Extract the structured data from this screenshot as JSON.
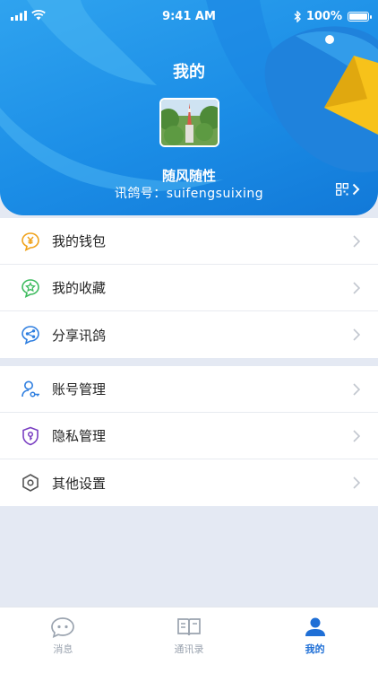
{
  "status_bar": {
    "time": "9:41 AM",
    "battery": "100%"
  },
  "header": {
    "title": "我的",
    "username": "随风随性",
    "account_label": "讯鸽号：suifengsuixing"
  },
  "menu_group_1": [
    {
      "label": "我的钱包",
      "icon": "wallet-yen-icon"
    },
    {
      "label": "我的收藏",
      "icon": "favorites-star-icon"
    },
    {
      "label": "分享讯鸽",
      "icon": "share-icon"
    }
  ],
  "menu_group_2": [
    {
      "label": "账号管理",
      "icon": "account-key-icon"
    },
    {
      "label": "隐私管理",
      "icon": "privacy-shield-icon"
    },
    {
      "label": "其他设置",
      "icon": "settings-hexagon-icon"
    }
  ],
  "tabbar": [
    {
      "label": "消息",
      "icon": "chat-bubble-icon",
      "active": false
    },
    {
      "label": "通讯录",
      "icon": "contacts-book-icon",
      "active": false
    },
    {
      "label": "我的",
      "icon": "profile-person-icon",
      "active": true
    }
  ],
  "colors": {
    "accent": "#1f6fd6",
    "header_blue": "#1b8de6",
    "wallet": "#f0a21a",
    "favorites": "#3dbb5e",
    "share": "#2f7fe0",
    "account": "#2f7fe0",
    "privacy": "#7a3fc2",
    "settings": "#555555"
  }
}
